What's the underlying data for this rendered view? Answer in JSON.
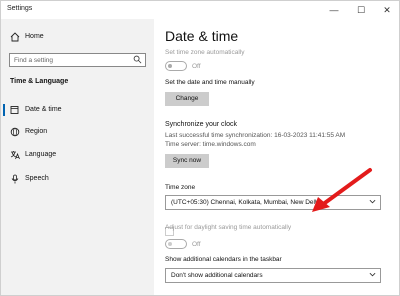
{
  "window": {
    "title": "Settings",
    "minimize": "—",
    "maximize": "☐",
    "close": "✕"
  },
  "sidebar": {
    "home": "Home",
    "search_placeholder": "Find a setting",
    "section": "Time & Language",
    "items": [
      {
        "label": "Date & time",
        "icon": "calendar-clock-icon"
      },
      {
        "label": "Region",
        "icon": "globe-icon"
      },
      {
        "label": "Language",
        "icon": "language-icon"
      },
      {
        "label": "Speech",
        "icon": "microphone-icon"
      }
    ]
  },
  "main": {
    "title": "Date & time",
    "set_tz_auto_label": "Set time zone automatically",
    "set_tz_auto_state": "Off",
    "set_manually_label": "Set the date and time manually",
    "change_button": "Change",
    "sync_heading": "Synchronize your clock",
    "last_sync": "Last successful time synchronization: 16-03-2023 11:41:55 AM",
    "time_server": "Time server: time.windows.com",
    "sync_button": "Sync now",
    "timezone_label": "Time zone",
    "timezone_value": "(UTC+05:30) Chennai, Kolkata, Mumbai, New Delhi",
    "dst_label": "Adjust for daylight saving time automatically",
    "dst_state": "Off",
    "calendars_label": "Show additional calendars in the taskbar",
    "calendars_value": "Don't show additional calendars"
  },
  "colors": {
    "accent": "#0063b1",
    "annotation": "#e31b1b",
    "sidebar_bg": "#f2f2f2"
  }
}
